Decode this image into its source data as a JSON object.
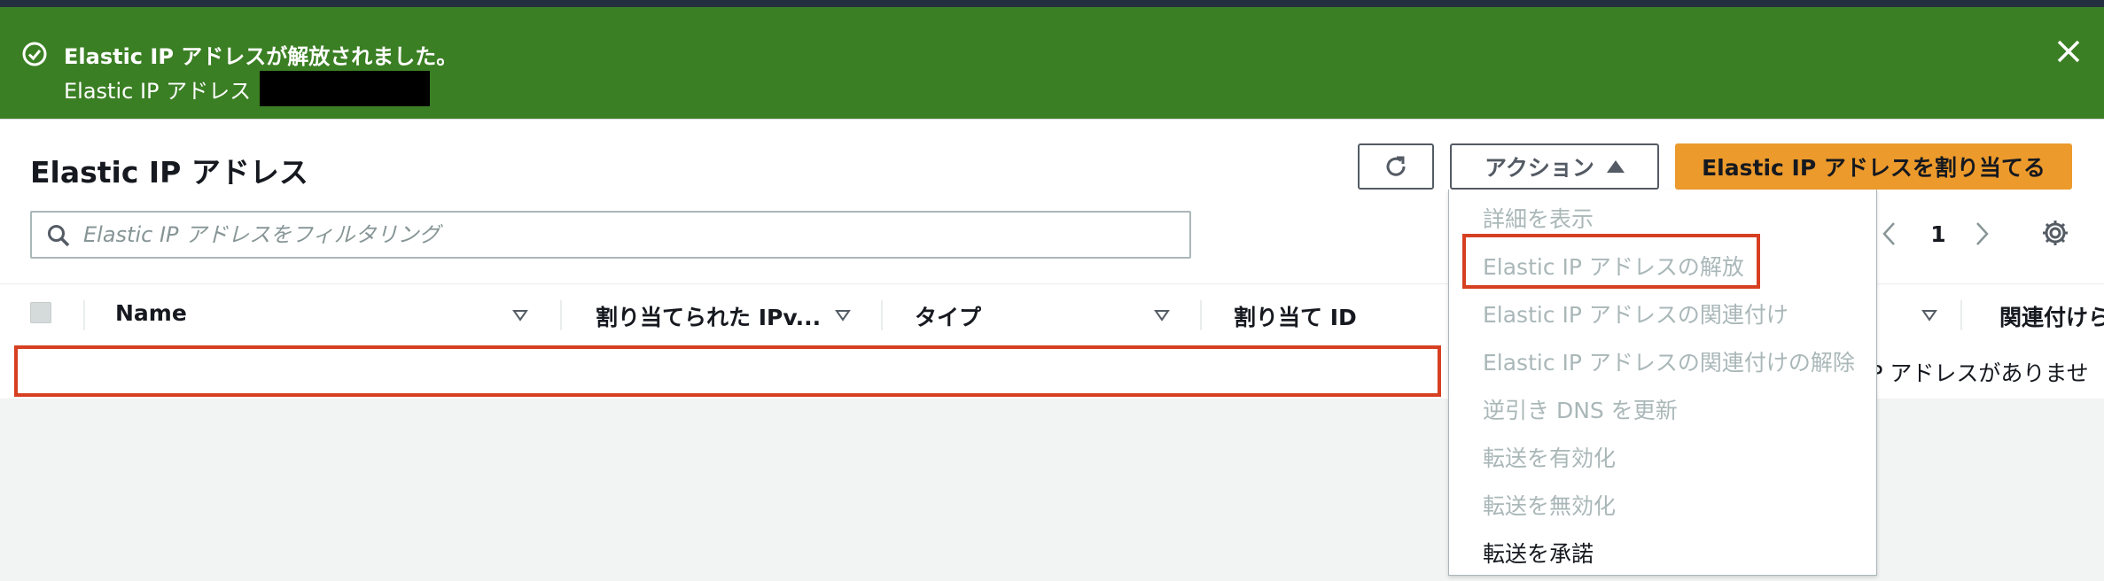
{
  "flash": {
    "title": "Elastic IP アドレスが解放されました。",
    "subtitle": "Elastic IP アドレス",
    "color": "#3b7f24"
  },
  "header": {
    "title": "Elastic IP アドレス",
    "actions_label": "アクション",
    "primary_label": "Elastic IP アドレスを割り当てる"
  },
  "search": {
    "placeholder": "Elastic IP アドレスをフィルタリング"
  },
  "pagination": {
    "current_page": "1"
  },
  "table": {
    "columns": [
      "Name",
      "割り当てられた IPv...",
      "タイプ",
      "割り当て ID",
      "関連付けら"
    ],
    "empty_text": "IP アドレスがありませ"
  },
  "actions_menu": {
    "items": [
      {
        "label": "詳細を表示",
        "enabled": false
      },
      {
        "label": "Elastic IP アドレスの解放",
        "enabled": false
      },
      {
        "label": "Elastic IP アドレスの関連付け",
        "enabled": false
      },
      {
        "label": "Elastic IP アドレスの関連付けの解除",
        "enabled": false
      },
      {
        "label": "逆引き DNS を更新",
        "enabled": false
      },
      {
        "label": "転送を有効化",
        "enabled": false
      },
      {
        "label": "転送を無効化",
        "enabled": false
      },
      {
        "label": "転送を承諾",
        "enabled": true
      }
    ]
  },
  "colors": {
    "primary_button": "#ec9a2c",
    "highlight": "#d63f21"
  }
}
